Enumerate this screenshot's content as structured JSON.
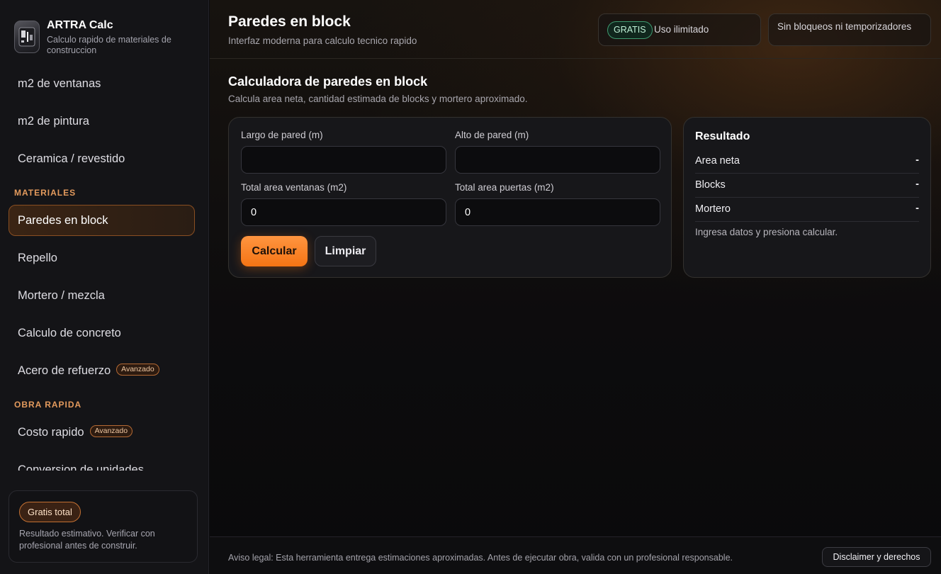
{
  "brand": {
    "title": "ARTRA Calc",
    "subtitle": "Calculo rapido de materiales de construccion"
  },
  "sidebar": {
    "items_top": [
      {
        "label": "m2 de ventanas"
      },
      {
        "label": "m2 de pintura"
      },
      {
        "label": "Ceramica / revestido"
      }
    ],
    "section_materiales": "MATERIALES",
    "items_materiales": [
      {
        "label": "Paredes en block",
        "active": true
      },
      {
        "label": "Repello"
      },
      {
        "label": "Mortero / mezcla"
      },
      {
        "label": "Calculo de concreto"
      },
      {
        "label": "Acero de refuerzo",
        "badge": "Avanzado"
      }
    ],
    "section_obra": "OBRA RAPIDA",
    "items_obra": [
      {
        "label": "Costo rapido",
        "badge": "Avanzado"
      },
      {
        "label": "Conversion de unidades"
      }
    ],
    "card": {
      "pill": "Gratis total",
      "text": "Resultado estimativo. Verificar con profesional antes de construir."
    }
  },
  "header": {
    "title": "Paredes en block",
    "subtitle": "Interfaz moderna para calculo tecnico rapido",
    "chip_badge": "GRATIS",
    "chip_text": "Uso ilimitado",
    "chip2_text": "Sin bloqueos ni temporizadores"
  },
  "calculator": {
    "title": "Calculadora de paredes en block",
    "subtitle": "Calcula area neta, cantidad estimada de blocks y mortero aproximado.",
    "fields": {
      "largo_label": "Largo de pared (m)",
      "largo_value": "",
      "alto_label": "Alto de pared (m)",
      "alto_value": "",
      "ventanas_label": "Total area ventanas (m2)",
      "ventanas_value": "0",
      "puertas_label": "Total area puertas (m2)",
      "puertas_value": "0"
    },
    "calc_button": "Calcular",
    "clear_button": "Limpiar"
  },
  "result": {
    "title": "Resultado",
    "rows": [
      {
        "label": "Area neta",
        "value": "-"
      },
      {
        "label": "Blocks",
        "value": "-"
      },
      {
        "label": "Mortero",
        "value": "-"
      }
    ],
    "note": "Ingresa datos y presiona calcular."
  },
  "footer": {
    "text": "Aviso legal: Esta herramienta entrega estimaciones aproximadas. Antes de ejecutar obra, valida con un profesional responsable.",
    "button": "Disclaimer y derechos"
  },
  "colors": {
    "accent": "#f57414",
    "sidebar_bg": "#141417",
    "badge_green": "#3f9a70"
  }
}
